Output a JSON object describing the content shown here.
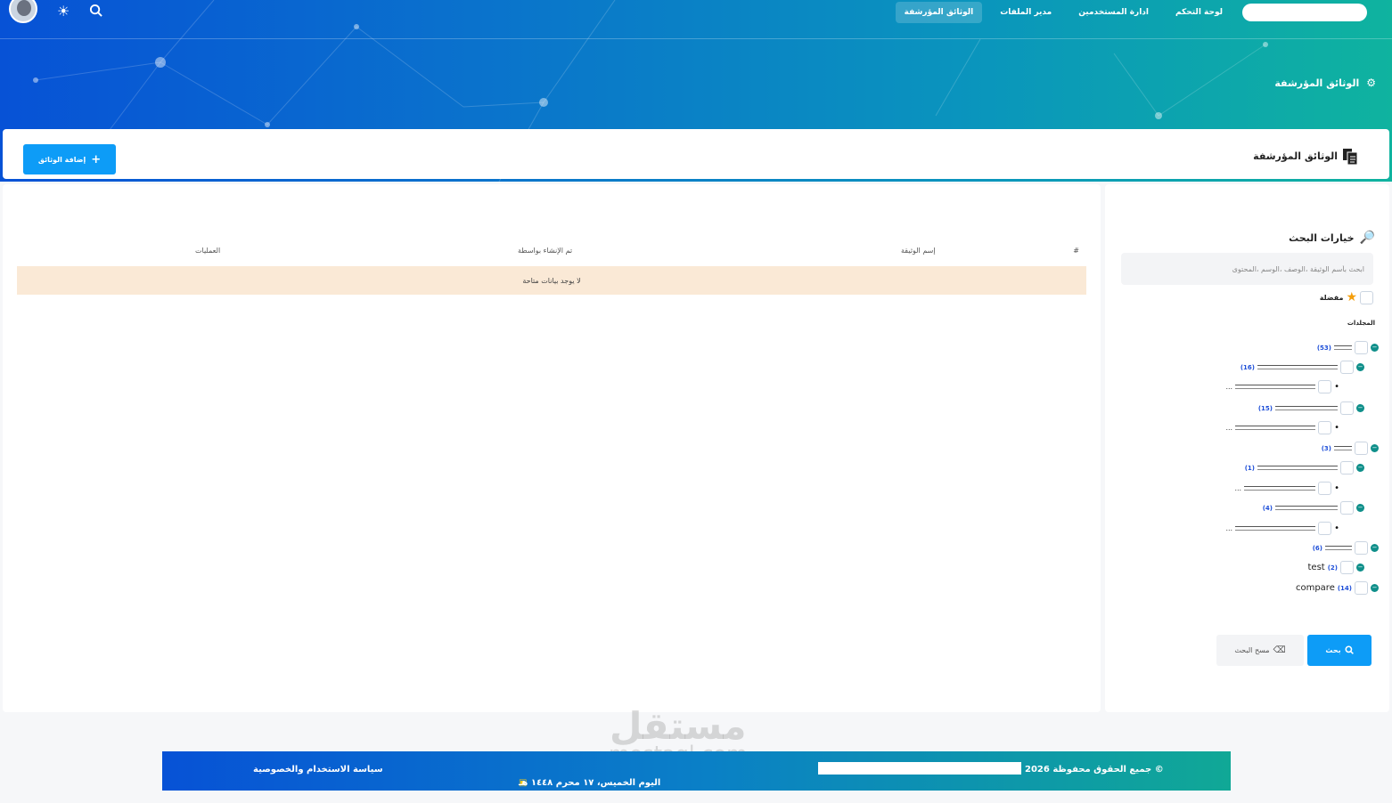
{
  "nav": {
    "items": [
      {
        "label": "لوحة التحكم",
        "active": false
      },
      {
        "label": "ادارة المستخدمين",
        "active": false
      },
      {
        "label": "مدير الملفات",
        "active": false
      },
      {
        "label": "الوثائق المؤرشفة",
        "active": true
      }
    ],
    "icons": {
      "search": "search-icon",
      "theme": "sun-icon",
      "avatar": "avatar"
    }
  },
  "hero": {
    "title": "الوثائق المؤرشفة",
    "icon": "settings-icon"
  },
  "title_card": {
    "title": "الوثائق المؤرشفة",
    "add_button": "إضافة الوثائق",
    "icon": "documents-icon"
  },
  "table": {
    "headers": {
      "index": "#",
      "name": "إسم الوثيقة",
      "created_by": "تم الإنشاء بواسطة",
      "actions": "العمليات"
    },
    "empty_text": "لا يوجد بيانات متاحة"
  },
  "sidebar": {
    "title": "خيارات البحث",
    "search_placeholder": "ابحث بأسم الوثيقة ،الوصف ،الوسم ،المحتوى",
    "favorite_label": "مفضلة",
    "folders_label": "المجلدات",
    "folders": [
      {
        "name": "",
        "count": "(53)"
      },
      {
        "name": "",
        "count": "(16)"
      },
      {
        "name": "...",
        "count": ""
      },
      {
        "name": "",
        "count": "(15)"
      },
      {
        "name": "...",
        "count": ""
      },
      {
        "name": "",
        "count": "(3)"
      },
      {
        "name": "",
        "count": "(1)"
      },
      {
        "name": "...",
        "count": ""
      },
      {
        "name": "",
        "count": "(4)"
      },
      {
        "name": "...",
        "count": ""
      },
      {
        "name": "",
        "count": "(6)"
      },
      {
        "name": "test",
        "count": "(2)"
      },
      {
        "name": "compare",
        "count": "(14)"
      }
    ],
    "search_button": "بحث",
    "clear_button": "مسح البحث"
  },
  "footer": {
    "copyright": "جميع الحقوق محفوظة 2026 ©",
    "date": "اليوم الخميس، ١٧ محرم ١٤٤٨ هـ",
    "policy": "سياسة الاستخدام والخصوصية"
  },
  "watermark": {
    "ar": "مستقل",
    "en": "mostaql.com"
  },
  "colors": {
    "primary": "#0d9cf7",
    "hero_start": "#0752d6",
    "hero_end": "#0fb39f",
    "empty_row": "#fae9d6",
    "toggle": "#0f8f8a"
  }
}
